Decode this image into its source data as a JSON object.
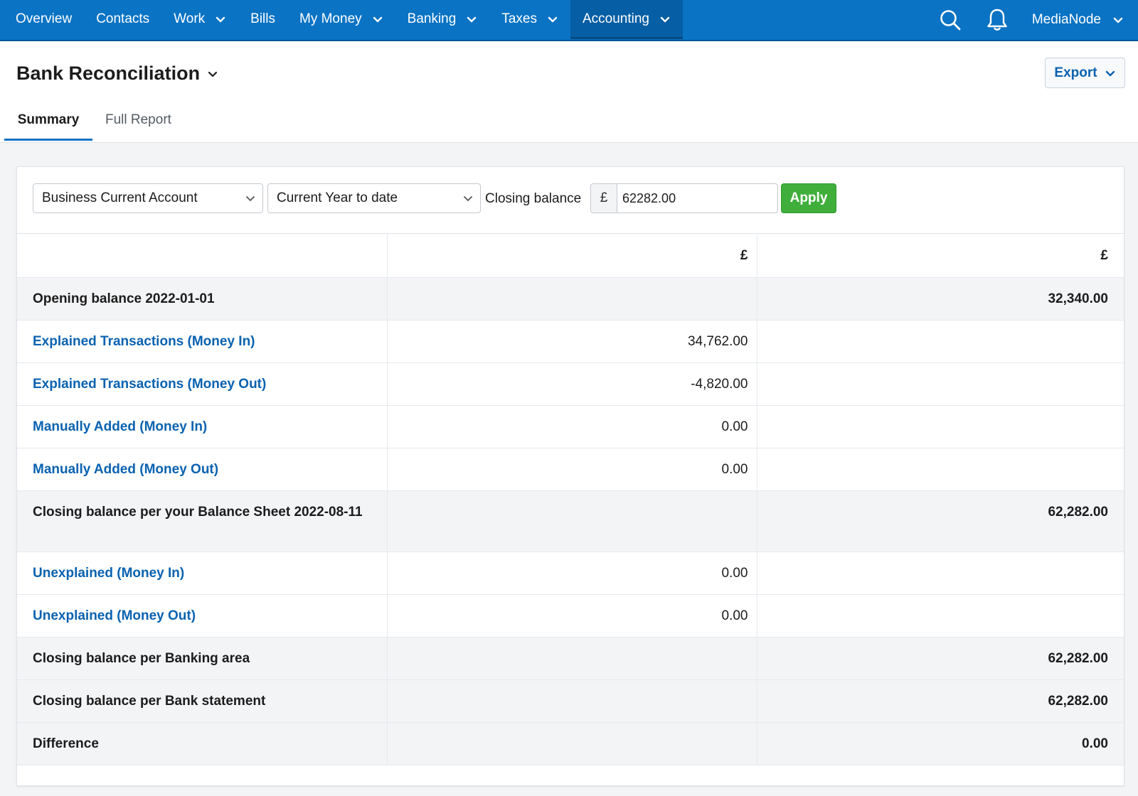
{
  "nav": {
    "items": [
      {
        "label": "Overview",
        "dropdown": false
      },
      {
        "label": "Contacts",
        "dropdown": false
      },
      {
        "label": "Work",
        "dropdown": true
      },
      {
        "label": "Bills",
        "dropdown": false
      },
      {
        "label": "My Money",
        "dropdown": true
      },
      {
        "label": "Banking",
        "dropdown": true
      },
      {
        "label": "Taxes",
        "dropdown": true
      },
      {
        "label": "Accounting",
        "dropdown": true,
        "active": true
      }
    ],
    "user": "MediaNode"
  },
  "page": {
    "title": "Bank Reconciliation",
    "export_label": "Export",
    "tabs": [
      {
        "label": "Summary",
        "active": true
      },
      {
        "label": "Full Report",
        "active": false
      }
    ]
  },
  "filters": {
    "account": "Business Current Account",
    "period": "Current Year to date",
    "closing_balance_label": "Closing balance",
    "currency_symbol": "£",
    "closing_balance_value": "62282.00",
    "apply_label": "Apply"
  },
  "table": {
    "header": {
      "c1": "",
      "c2": "£",
      "c3": "£"
    },
    "rows": [
      {
        "label": "Opening balance 2022-01-01",
        "c2": "",
        "c3": "32,340.00",
        "kind": "total"
      },
      {
        "label": "Explained Transactions (Money In)",
        "c2": "34,762.00",
        "c3": "",
        "kind": "link"
      },
      {
        "label": "Explained Transactions (Money Out)",
        "c2": "-4,820.00",
        "c3": "",
        "kind": "link"
      },
      {
        "label": "Manually Added (Money In)",
        "c2": "0.00",
        "c3": "",
        "kind": "link"
      },
      {
        "label": "Manually Added (Money Out)",
        "c2": "0.00",
        "c3": "",
        "kind": "link"
      },
      {
        "label": "Closing balance per your Balance Sheet 2022-08-11",
        "c2": "",
        "c3": "62,282.00",
        "kind": "total"
      },
      {
        "label": "Unexplained (Money In)",
        "c2": "0.00",
        "c3": "",
        "kind": "link"
      },
      {
        "label": "Unexplained (Money Out)",
        "c2": "0.00",
        "c3": "",
        "kind": "link"
      },
      {
        "label": "Closing balance per Banking area",
        "c2": "",
        "c3": "62,282.00",
        "kind": "total"
      },
      {
        "label": "Closing balance per Bank statement",
        "c2": "",
        "c3": "62,282.00",
        "kind": "total"
      },
      {
        "label": "Difference",
        "c2": "",
        "c3": "0.00",
        "kind": "total"
      }
    ]
  },
  "colors": {
    "nav_bg": "#0a73c4",
    "link": "#0a62b0",
    "apply": "#3fae3b"
  }
}
